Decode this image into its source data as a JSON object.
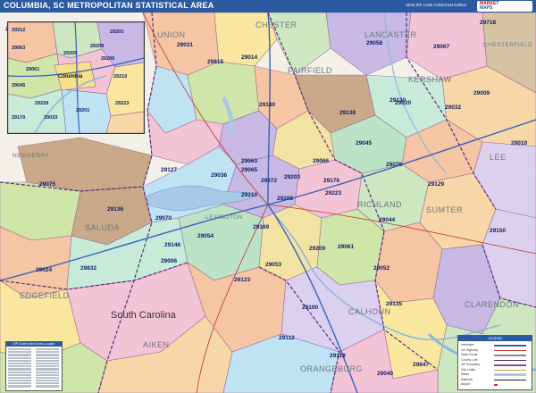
{
  "header": {
    "title": "COLUMBIA, SC METROPOLITAN STATISTICAL AREA",
    "edition": "2026 ZIP Code Color/Cast Edition",
    "logo_line1": "MARKET",
    "logo_line2": "MAPS"
  },
  "state_label": "South Carolina",
  "counties": [
    "UNION",
    "CHESTER",
    "LANCASTER",
    "CHESTERFIELD",
    "FAIRFIELD",
    "KERSHAW",
    "LEE",
    "NEWBERRY",
    "RICHLAND",
    "SUMTER",
    "SALUDA",
    "LEXINGTON",
    "EDGEFIELD",
    "CALHOUN",
    "CLARENDON",
    "AIKEN",
    "ORANGEBURG"
  ],
  "zip_codes": [
    "29212",
    "29060",
    "29031",
    "29724",
    "29058",
    "29067",
    "29718",
    "29815",
    "29014",
    "29180",
    "29138",
    "29130",
    "29020",
    "29032",
    "29009",
    "29030",
    "29127",
    "29065",
    "29063",
    "29036",
    "29045",
    "29078",
    "29010",
    "29066",
    "29176",
    "29075",
    "29072",
    "29129",
    "29136",
    "29070",
    "29054",
    "29169",
    "29061",
    "29053",
    "29123",
    "29209",
    "29044",
    "29052",
    "29847",
    "29024",
    "29832",
    "29006",
    "29135",
    "29118",
    "29146",
    "29112",
    "29040",
    "29128",
    "29033",
    "29205",
    "29201",
    "29203",
    "29210",
    "29223",
    "29150",
    "29100",
    "29171"
  ],
  "inset": {
    "city_label": "Columbia",
    "zips": [
      "29212",
      "29063",
      "29205",
      "29209",
      "29203",
      "29210",
      "29201",
      "29033",
      "29170",
      "29045",
      "29223",
      "29061",
      "29206",
      "29229"
    ]
  },
  "legend": {
    "title": "LEGEND",
    "items": [
      "Interstate",
      "US Highway",
      "State Route",
      "County Line",
      "ZIP Boundary",
      "City Limits",
      "Water",
      "Railroad",
      "Airport"
    ]
  },
  "zip_index": {
    "title": "ZIP Code Index/Cross Locator"
  },
  "colors": {
    "title_bar": "#2c5aa0",
    "water": "#a9c9e6",
    "zip_label": "#0b1a66",
    "county_label": "#6d7580"
  }
}
